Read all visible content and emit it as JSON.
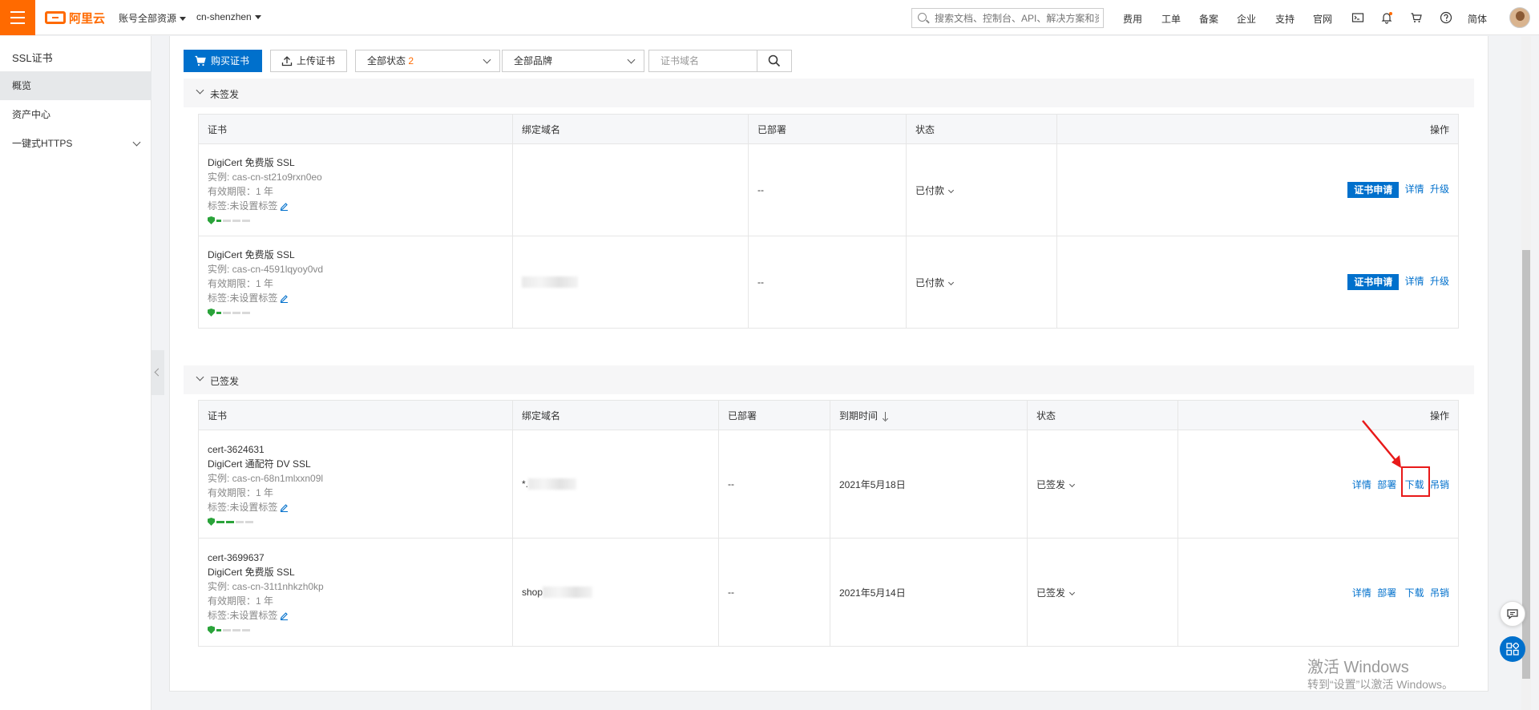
{
  "topbar": {
    "account_scope": "账号全部资源",
    "region": "cn-shenzhen",
    "search_placeholder": "搜索文档、控制台、API、解决方案和资源",
    "nav": [
      "费用",
      "工单",
      "备案",
      "企业",
      "支持",
      "官网"
    ],
    "language": "简体",
    "brand_color": "#ff6a00"
  },
  "sidebar": {
    "title": "SSL证书",
    "items": [
      {
        "label": "概览",
        "active": true
      },
      {
        "label": "资产中心",
        "active": false
      },
      {
        "label": "一键式HTTPS",
        "active": false
      }
    ]
  },
  "toolbar": {
    "buy_label": "购买证书",
    "upload_label": "上传证书",
    "status_filter": "全部状态",
    "status_count": "2",
    "brand_filter": "全部品牌",
    "domain_placeholder": "证书域名"
  },
  "unissued": {
    "title": "未签发",
    "headers": [
      "证书",
      "绑定域名",
      "已部署",
      "状态",
      "操作"
    ],
    "rows": [
      {
        "name": "DigiCert 免费版 SSL",
        "instance": "实例: cas-cn-st21o9rxn0eo",
        "validity": "有效期限：1 年",
        "tags": "标签:未设置标签",
        "deployed": "--",
        "status": "已付款",
        "apply": "证书申请",
        "detail": "详情",
        "upgrade": "升级"
      },
      {
        "name": "DigiCert 免费版 SSL",
        "instance": "实例: cas-cn-4591lqyoy0vd",
        "validity": "有效期限：1 年",
        "tags": "标签:未设置标签",
        "deployed": "--",
        "status": "已付款",
        "apply": "证书申请",
        "detail": "详情",
        "upgrade": "升级"
      }
    ]
  },
  "issued": {
    "title": "已签发",
    "headers": [
      "证书",
      "绑定域名",
      "已部署",
      "到期时间",
      "状态",
      "操作"
    ],
    "rows": [
      {
        "id": "cert-3624631",
        "name": "DigiCert 通配符 DV SSL",
        "instance": "实例: cas-cn-68n1mlxxn09l",
        "validity": "有效期限：1 年",
        "tags": "标签:未设置标签",
        "domain": "*.",
        "deployed": "--",
        "expiry": "2021年5月18日",
        "status": "已签发",
        "detail": "详情",
        "deploy": "部署",
        "download": "下载",
        "revoke": "吊销"
      },
      {
        "id": "cert-3699637",
        "name": "DigiCert 免费版 SSL",
        "instance": "实例: cas-cn-31t1nhkzh0kp",
        "validity": "有效期限：1 年",
        "tags": "标签:未设置标签",
        "domain": "shop",
        "deployed": "--",
        "expiry": "2021年5月14日",
        "status": "已签发",
        "detail": "详情",
        "deploy": "部署",
        "download": "下载",
        "revoke": "吊销"
      }
    ]
  },
  "watermark": {
    "line1": "激活 Windows",
    "line2": "转到“设置”以激活 Windows。"
  }
}
